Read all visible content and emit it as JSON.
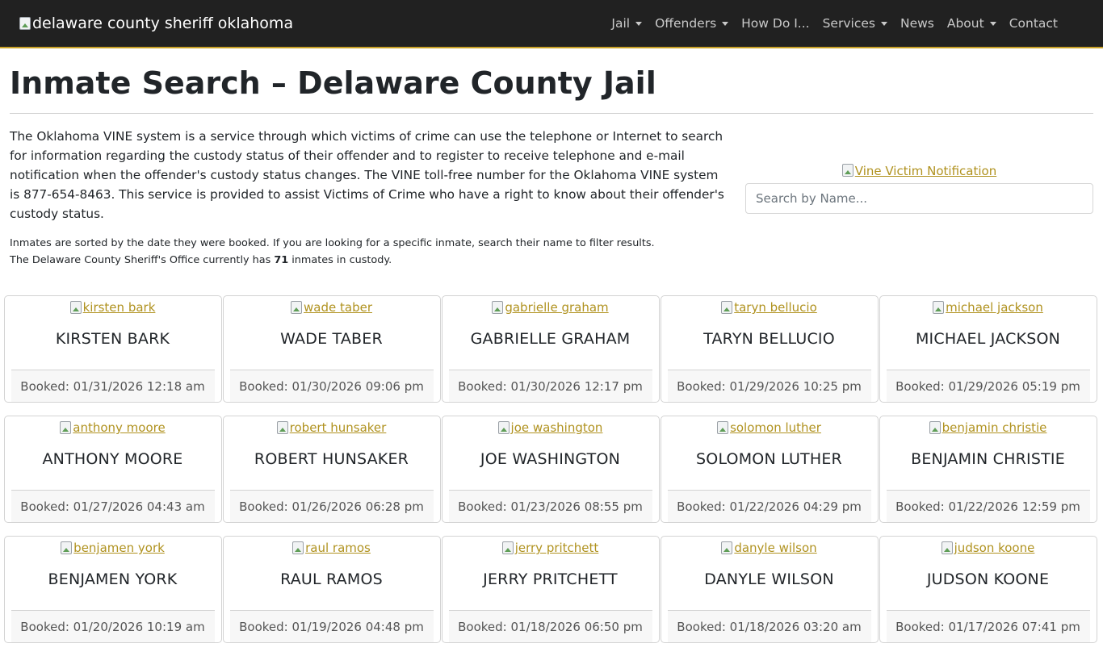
{
  "nav": {
    "brand_alt": "delaware county sheriff oklahoma",
    "items": [
      {
        "label": "Jail",
        "dropdown": true
      },
      {
        "label": "Offenders",
        "dropdown": true
      },
      {
        "label": "How Do I...",
        "dropdown": false
      },
      {
        "label": "Services",
        "dropdown": true
      },
      {
        "label": "News",
        "dropdown": false
      },
      {
        "label": "About",
        "dropdown": true
      },
      {
        "label": "Contact",
        "dropdown": false
      }
    ]
  },
  "page": {
    "title": "Inmate Search – Delaware County Jail",
    "intro": "The Oklahoma VINE system is a service through which victims of crime can use the telephone or Internet to search for information regarding the custody status of their offender and to register to receive telephone and e-mail notification when the offender's custody status changes. The VINE toll-free number for the Oklahoma VINE system is 877-654-8463. This service is provided to assist Victims of Crime who have a right to know about their offender's custody status.",
    "sort_note": "Inmates are sorted by the date they were booked. If you are looking for a specific inmate, search their name to filter results.",
    "count_prefix": "The Delaware County Sheriff's Office currently has",
    "count": "71",
    "count_suffix": "inmates in custody.",
    "vine_alt": "Vine Victim Notification",
    "search_placeholder": "Search by Name..."
  },
  "colors": {
    "navbar_bg": "#212121",
    "accent": "#c9a227",
    "link": "#b0921f"
  },
  "inmates": [
    {
      "alt": "kirsten bark",
      "name": "KIRSTEN BARK",
      "booked": "Booked: 01/31/2026 12:18 am"
    },
    {
      "alt": "wade taber",
      "name": "WADE TABER",
      "booked": "Booked: 01/30/2026 09:06 pm"
    },
    {
      "alt": "gabrielle graham",
      "name": "GABRIELLE GRAHAM",
      "booked": "Booked: 01/30/2026 12:17 pm"
    },
    {
      "alt": "taryn bellucio",
      "name": "TARYN BELLUCIO",
      "booked": "Booked: 01/29/2026 10:25 pm"
    },
    {
      "alt": "michael jackson",
      "name": "MICHAEL JACKSON",
      "booked": "Booked: 01/29/2026 05:19 pm"
    },
    {
      "alt": "anthony moore",
      "name": "ANTHONY MOORE",
      "booked": "Booked: 01/27/2026 04:43 am"
    },
    {
      "alt": "robert hunsaker",
      "name": "ROBERT HUNSAKER",
      "booked": "Booked: 01/26/2026 06:28 pm"
    },
    {
      "alt": "joe washington",
      "name": "JOE WASHINGTON",
      "booked": "Booked: 01/23/2026 08:55 pm"
    },
    {
      "alt": "solomon luther",
      "name": "SOLOMON LUTHER",
      "booked": "Booked: 01/22/2026 04:29 pm"
    },
    {
      "alt": "benjamin christie",
      "name": "BENJAMIN CHRISTIE",
      "booked": "Booked: 01/22/2026 12:59 pm"
    },
    {
      "alt": "benjamen york",
      "name": "BENJAMEN YORK",
      "booked": "Booked: 01/20/2026 10:19 am"
    },
    {
      "alt": "raul ramos",
      "name": "RAUL RAMOS",
      "booked": "Booked: 01/19/2026 04:48 pm"
    },
    {
      "alt": "jerry pritchett",
      "name": "JERRY PRITCHETT",
      "booked": "Booked: 01/18/2026 06:50 pm"
    },
    {
      "alt": "danyle wilson",
      "name": "DANYLE WILSON",
      "booked": "Booked: 01/18/2026 03:20 am"
    },
    {
      "alt": "judson koone",
      "name": "JUDSON KOONE",
      "booked": "Booked: 01/17/2026 07:41 pm"
    }
  ]
}
